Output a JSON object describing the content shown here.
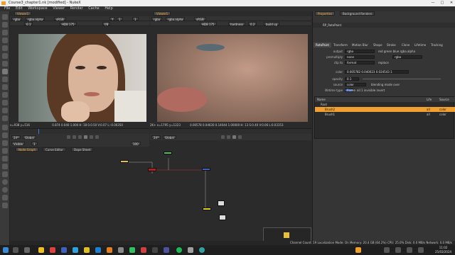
{
  "window": {
    "title": "Course3_chapter1.nk [modified] - NukeX",
    "minimize": "—",
    "maximize": "□",
    "close": "✕"
  },
  "menu": [
    "File",
    "Edit",
    "Workspace",
    "Viewer",
    "Render",
    "Cache",
    "Help"
  ],
  "viewer1": {
    "tab": "Viewer1",
    "channel": "rgba",
    "channel2": "rgba.alpha",
    "colorspace": "sRGB",
    "frame": "1",
    "gain_label": "f/8",
    "gain": "1",
    "y_label": "Y",
    "y_value": "1",
    "zoom": "2D",
    "proxy": "",
    "res": "HD8 175",
    "opacity": "0.1",
    "status": "x=938 y=516",
    "status_vals": "0.874  0.040  1.000  H: 18  0.0.50  V:0.07  L:-0.00350",
    "fps": "24*",
    "scope": "Global",
    "in": "1",
    "out": "100",
    "play_mode": "Visible",
    "ticks": [
      "1",
      "10",
      "20",
      "30",
      "40",
      "50",
      "60",
      "70",
      "80",
      "90",
      "100"
    ]
  },
  "viewer2": {
    "tab": "Viewer1",
    "channel": "rgba",
    "channel2": "rgba.alpha",
    "colorspace": "sRGB",
    "res": "HD8 175",
    "hardness_label": "hardness",
    "hardness": "0.2",
    "build_label": "build up",
    "status": "2K+  x=1795 y=1223",
    "status_vals": "0.00578  0.04630  0.14044  1.00000  H: 13  S:0.40  V:0.06  L:0.03153",
    "fps": "24*",
    "scope": "Global",
    "ticks": [
      "1",
      "10",
      "20",
      "30",
      "40",
      "50",
      "60",
      "70",
      "80",
      "90",
      "100"
    ]
  },
  "nodegraph": {
    "tabs": [
      "Node Graph",
      "Curve Editor",
      "Dope Sheet"
    ]
  },
  "properties": {
    "tabs": [
      "Properties",
      "Background Renders"
    ],
    "node_name": "RP_RotoPaint",
    "node_tabs": [
      "RotoPaint",
      "Transform",
      "Motion Blur",
      "Shape",
      "Stroke",
      "Clone",
      "Lifetime",
      "Tracking"
    ],
    "rows": [
      {
        "label": "output",
        "value": "rgba",
        "extra": "red  green  blue  rgba.alpha"
      },
      {
        "label": "premultiply",
        "value": "none",
        "extra": "rgba"
      },
      {
        "label": "clip to",
        "value": "format",
        "extra": "replace"
      },
      {
        "label": "color",
        "value": "0.005782  0.040023  0.024543  1",
        "extra": ""
      },
      {
        "label": "opacity",
        "value": "0.1",
        "extra": ""
      },
      {
        "label": "source",
        "value": "color",
        "extra": "blending mode  over"
      },
      {
        "label": "lifetime type",
        "value": "frame",
        "extra": "all  1   invisible  invert"
      }
    ],
    "tree_header": {
      "name": "Name",
      "life": "Life",
      "source": "Source"
    },
    "tree": [
      {
        "name": "Root",
        "life": "",
        "source": ""
      },
      {
        "name": "Brush2",
        "life": "all",
        "source": "color"
      },
      {
        "name": "Brush1",
        "life": "all",
        "source": "color"
      }
    ]
  },
  "statusbar": "Channel Count: 19  Localization Mode: On  Memory: 20.4 GB (64.2%)  CPU: 25.0%  Disk: 0.0 MB/s  Network: 0.0 MB/s",
  "taskbar": {
    "time": "11:02",
    "date": "25/03/2024"
  },
  "colors": {
    "selected_row": "#f0a030",
    "accent": "#f0a030"
  }
}
